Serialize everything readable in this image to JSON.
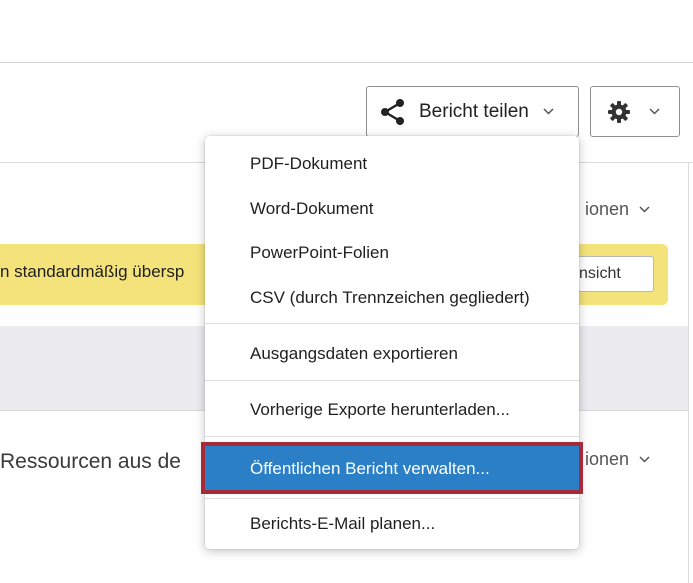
{
  "toolbar": {
    "share_label": "Bericht teilen",
    "share_icon": "share-icon",
    "settings_icon": "gear-icon"
  },
  "background": {
    "options_link_1": "ionen",
    "options_link_2": "ionen",
    "notice_text": "n standardmäßig übersp",
    "notice_button": "nsicht",
    "section_title": "Ressourcen aus de",
    "notice_color": "#f4e37a"
  },
  "menu": {
    "items": [
      {
        "label": "PDF-Dokument"
      },
      {
        "label": "Word-Dokument"
      },
      {
        "label": "PowerPoint-Folien"
      },
      {
        "label": "CSV (durch Trennzeichen gegliedert)"
      },
      {
        "label": "Ausgangsdaten exportieren"
      },
      {
        "label": "Vorherige Exporte herunterladen..."
      },
      {
        "label": "Öffentlichen Bericht verwalten..."
      },
      {
        "label": "Berichts-E-Mail planen..."
      }
    ],
    "selected_index": 6,
    "selected_bg": "#2a7fc7",
    "highlight_border": "#a52a3a"
  }
}
